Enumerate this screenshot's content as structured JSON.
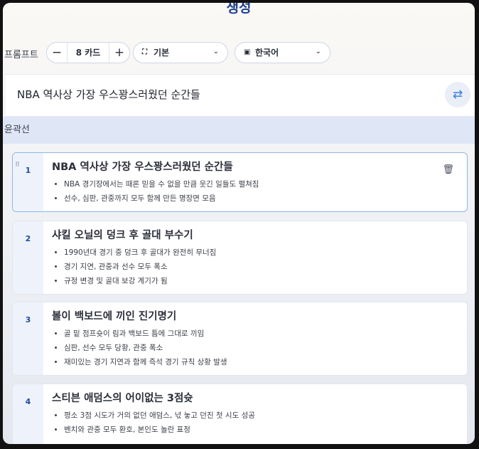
{
  "header": {
    "title": "생성"
  },
  "toolbar": {
    "label": "프롬프트",
    "stepper": {
      "minus": "−",
      "value": "8 카드",
      "plus": "+"
    },
    "theme_dropdown": {
      "value": "기본"
    },
    "language_dropdown": {
      "value": "한국어"
    }
  },
  "prompt": {
    "text": "NBA 역사상 가장 우스꽝스러웠던 순간들"
  },
  "outline": {
    "label": "윤곽선",
    "cards": [
      {
        "number": "1",
        "title": "NBA 역사상 가장 우스꽝스러웠던 순간들",
        "bullets": [
          "NBA 경기장에서는 때론 믿을 수 없을 만큼 웃긴 일들도 펼쳐짐",
          "선수, 심판, 관중까지 모두 함께 만든 명장면 모음"
        ]
      },
      {
        "number": "2",
        "title": "샤킬 오닐의 덩크 후 골대 부수기",
        "bullets": [
          "1990년대 경기 중 덩크 후 골대가 완전히 무너짐",
          "경기 지연, 관중과 선수 모두 폭소",
          "규정 변경 및 골대 보강 계기가 됨"
        ]
      },
      {
        "number": "3",
        "title": "볼이 백보드에 끼인 진기명기",
        "bullets": [
          "골 밑 점프슛이 림과 백보드 틈에 그대로 끼임",
          "심판, 선수 모두 당황, 관중 폭소",
          "재미있는 경기 지연과 함께 즉석 경기 규칙 상황 발생"
        ]
      },
      {
        "number": "4",
        "title": "스티븐 애덤스의 어이없는 3점슛",
        "bullets": [
          "평소 3점 시도가 거의 없던 애덤스, 넋 놓고 던진 첫 시도 성공",
          "벤치와 관중 모두 환호, 본인도 놀란 표정"
        ]
      }
    ]
  }
}
